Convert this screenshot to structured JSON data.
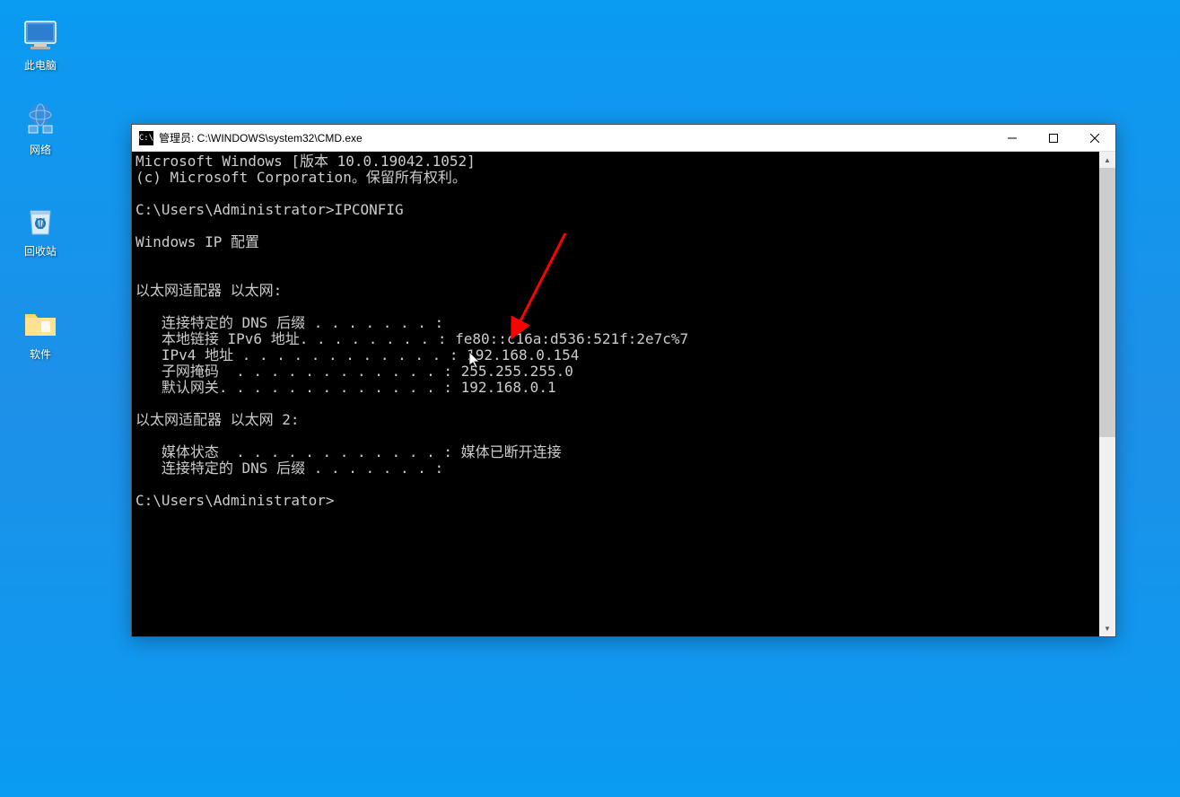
{
  "desktop": {
    "icons": [
      {
        "name": "this-pc",
        "label": "此电脑"
      },
      {
        "name": "network",
        "label": "网络"
      },
      {
        "name": "recycle-bin",
        "label": "回收站"
      },
      {
        "name": "software",
        "label": "软件"
      }
    ]
  },
  "window": {
    "title": "管理员: C:\\WINDOWS\\system32\\CMD.exe",
    "titlebar_icon": "C:\\"
  },
  "terminal": {
    "lines": [
      "Microsoft Windows [版本 10.0.19042.1052]",
      "(c) Microsoft Corporation。保留所有权利。",
      "",
      "C:\\Users\\Administrator>IPCONFIG",
      "",
      "Windows IP 配置",
      "",
      "",
      "以太网适配器 以太网:",
      "",
      "   连接特定的 DNS 后缀 . . . . . . . :",
      "   本地链接 IPv6 地址. . . . . . . . : fe80::c16a:d536:521f:2e7c%7",
      "   IPv4 地址 . . . . . . . . . . . . : 192.168.0.154",
      "   子网掩码  . . . . . . . . . . . . : 255.255.255.0",
      "   默认网关. . . . . . . . . . . . . : 192.168.0.1",
      "",
      "以太网适配器 以太网 2:",
      "",
      "   媒体状态  . . . . . . . . . . . . : 媒体已断开连接",
      "   连接特定的 DNS 后缀 . . . . . . . :",
      "",
      "C:\\Users\\Administrator>"
    ]
  },
  "network_data": {
    "os_version": "10.0.19042.1052",
    "command": "IPCONFIG",
    "adapter1": {
      "name": "以太网",
      "dns_suffix": "",
      "ipv6_link_local": "fe80::c16a:d536:521f:2e7c%7",
      "ipv4": "192.168.0.154",
      "subnet_mask": "255.255.255.0",
      "gateway": "192.168.0.1"
    },
    "adapter2": {
      "name": "以太网 2",
      "media_state": "媒体已断开连接",
      "dns_suffix": ""
    },
    "prompt": "C:\\Users\\Administrator>"
  },
  "annotation": {
    "arrow_color": "#ff0000"
  }
}
